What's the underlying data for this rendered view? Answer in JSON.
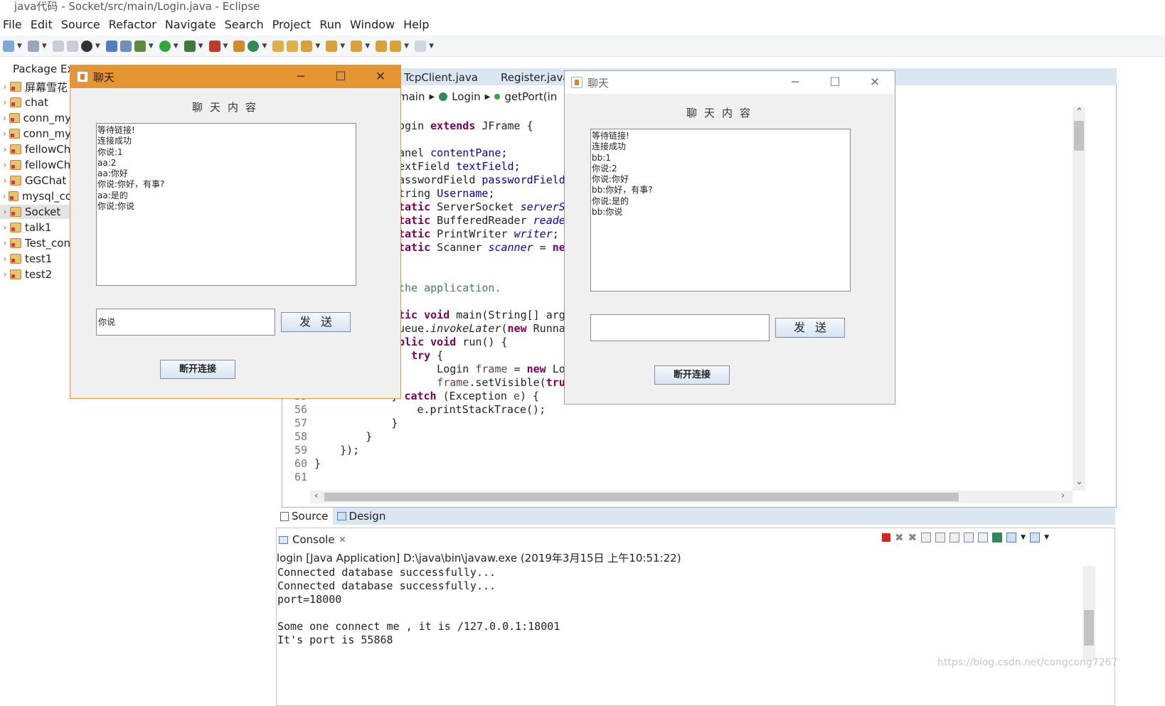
{
  "window": {
    "title": "java代码 - Socket/src/main/Login.java - Eclipse"
  },
  "menu": [
    "File",
    "Edit",
    "Source",
    "Refactor",
    "Navigate",
    "Search",
    "Project",
    "Run",
    "Window",
    "Help"
  ],
  "package_explorer": {
    "title": "Package Exp",
    "projects": [
      "屏幕雪花",
      "chat",
      "conn_my",
      "conn_my",
      "fellowCh",
      "fellowCh",
      "GGChat",
      "mysql_cc",
      "Socket",
      "talk1",
      "Test_con",
      "test1",
      "test2"
    ],
    "selected": "Socket"
  },
  "editor": {
    "tabs": [
      "TcpClient.java",
      "Register.java"
    ],
    "breadcrumb": [
      "main",
      "Login",
      "getPort(in"
    ],
    "code_lines": [
      {
        "n": "",
        "parts": [
          [
            "",
            "ogin "
          ],
          [
            "kw",
            "extends"
          ],
          [
            "",
            " JFrame {"
          ]
        ]
      },
      {
        "n": "",
        "parts": [
          [
            "",
            ""
          ]
        ]
      },
      {
        "n": "",
        "parts": [
          [
            "",
            "anel "
          ],
          [
            "fld",
            "contentPane"
          ],
          [
            "",
            ";"
          ]
        ]
      },
      {
        "n": "",
        "parts": [
          [
            "",
            "extField "
          ],
          [
            "fld",
            "textField"
          ],
          [
            "",
            ";"
          ]
        ]
      },
      {
        "n": "",
        "parts": [
          [
            "",
            "asswordField "
          ],
          [
            "fld",
            "passwordField"
          ],
          [
            "",
            ";"
          ]
        ]
      },
      {
        "n": "",
        "parts": [
          [
            "",
            "tring "
          ],
          [
            "fld",
            "Username"
          ],
          [
            "",
            ";"
          ]
        ]
      },
      {
        "n": "",
        "parts": [
          [
            "kw",
            "tatic"
          ],
          [
            "",
            " ServerSocket "
          ],
          [
            "fi",
            "serverSo"
          ]
        ]
      },
      {
        "n": "",
        "parts": [
          [
            "kw",
            "tatic"
          ],
          [
            "",
            " BufferedReader "
          ],
          [
            "fi",
            "reader"
          ]
        ]
      },
      {
        "n": "",
        "parts": [
          [
            "kw",
            "tatic"
          ],
          [
            "",
            " PrintWriter "
          ],
          [
            "fi",
            "writer"
          ],
          [
            "",
            ";"
          ]
        ]
      },
      {
        "n": "",
        "parts": [
          [
            "kw",
            "tatic"
          ],
          [
            "",
            " Scanner "
          ],
          [
            "fi",
            "scanner"
          ],
          [
            "",
            " = "
          ],
          [
            "kw",
            "new"
          ]
        ]
      },
      {
        "n": "",
        "parts": [
          [
            "",
            ""
          ]
        ]
      },
      {
        "n": "",
        "parts": [
          [
            "",
            ""
          ]
        ]
      },
      {
        "n": "",
        "parts": [
          [
            "cm",
            "the application."
          ]
        ]
      },
      {
        "n": "",
        "parts": [
          [
            "",
            ""
          ]
        ]
      },
      {
        "n": "",
        "parts": [
          [
            "kw",
            "tic void"
          ],
          [
            "",
            " main(String[] args"
          ]
        ]
      },
      {
        "n": "",
        "parts": [
          [
            "",
            "ueue."
          ],
          [
            "i",
            "invokeLater"
          ],
          [
            "",
            "("
          ],
          [
            "kw",
            "new"
          ],
          [
            "",
            " Runnab"
          ]
        ]
      },
      {
        "n": "",
        "parts": [
          [
            "kw",
            "blic void"
          ],
          [
            "",
            " run() {"
          ]
        ]
      },
      {
        "n": "",
        "parts": [
          [
            "",
            "  "
          ],
          [
            "kw",
            "try"
          ],
          [
            "",
            " {"
          ]
        ]
      },
      {
        "n": "",
        "parts": [
          [
            "",
            "      Login "
          ],
          [
            "frm",
            "frame"
          ],
          [
            "",
            " = "
          ],
          [
            "kw",
            "new"
          ],
          [
            "",
            " Log"
          ]
        ]
      },
      {
        "n": "",
        "parts": [
          [
            "",
            "      "
          ],
          [
            "frm",
            "frame"
          ],
          [
            "",
            ".setVisible("
          ],
          [
            "kw",
            "true"
          ]
        ]
      },
      {
        "n": "55",
        "parts": [
          [
            "",
            "            } "
          ],
          [
            "kw",
            "catch"
          ],
          [
            "",
            " (Exception "
          ],
          [
            "frm",
            "e"
          ],
          [
            "",
            ") {"
          ]
        ]
      },
      {
        "n": "56",
        "parts": [
          [
            "",
            "                e.printStackTrace();"
          ]
        ]
      },
      {
        "n": "57",
        "parts": [
          [
            "",
            "            }"
          ]
        ]
      },
      {
        "n": "58",
        "parts": [
          [
            "",
            "        }"
          ]
        ]
      },
      {
        "n": "59",
        "parts": [
          [
            "",
            "    });"
          ]
        ]
      },
      {
        "n": "60",
        "parts": [
          [
            "",
            "}"
          ]
        ]
      },
      {
        "n": "61",
        "parts": [
          [
            "",
            ""
          ]
        ]
      }
    ]
  },
  "bottom_tabs": [
    "Source",
    "Design"
  ],
  "console": {
    "tab": "Console",
    "description": "login [Java Application] D:\\java\\bin\\javaw.exe (2019年3月15日 上午10:51:22)",
    "lines": [
      "Connected database successfully...",
      "Connected database successfully...",
      "port=18000",
      "",
      "Some one connect me , it is /127.0.0.1:18001",
      "It's port is 55868"
    ],
    "watermark": "https://blog.csdn.net/congcong7267"
  },
  "chat_left": {
    "title": "聊天",
    "heading": "聊天内容",
    "messages": [
      "等待链接!",
      "连接成功",
      "你说:1",
      "aa:2",
      "aa:你好",
      "你说:你好，有事?",
      "aa:是的",
      "你说:你说"
    ],
    "input": "你说",
    "send": "发送",
    "disconnect": "断开连接"
  },
  "chat_right": {
    "title": "聊天",
    "heading": "聊天内容",
    "messages": [
      "等待链接!",
      "连接成功",
      "bb:1",
      "你说:2",
      "你说:你好",
      "bb:你好，有事?",
      "你说:是的",
      "bb:你说"
    ],
    "input": "",
    "send": "发送",
    "disconnect": "断开连接"
  },
  "colors": {
    "active_title": "#e59633",
    "inactive_title": "#ffffff"
  }
}
